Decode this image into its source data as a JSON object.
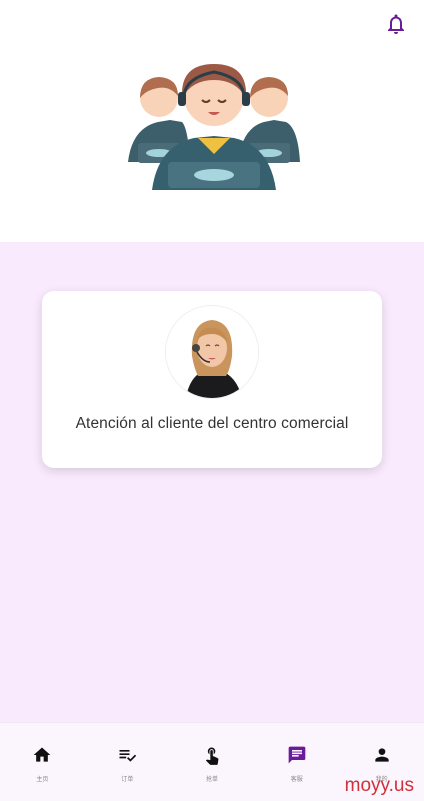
{
  "colors": {
    "accent": "#6a1b9a",
    "panel_background": "#f9ebfd",
    "nav_background": "#fbf6fd",
    "watermark": "#d0303a"
  },
  "header": {
    "notification_icon": "bell-icon"
  },
  "hero": {
    "image": "customer-service-team-illustration"
  },
  "card": {
    "avatar": "support-agent-photo",
    "label": "Atención al cliente del centro comercial"
  },
  "bottom_nav": {
    "items": [
      {
        "icon": "home-icon",
        "label": "主页"
      },
      {
        "icon": "playlist-check-icon",
        "label": "订单"
      },
      {
        "icon": "touch-icon",
        "label": "抢单"
      },
      {
        "icon": "message-icon",
        "label": "客服",
        "active": true
      },
      {
        "icon": "person-icon",
        "label": "我的"
      }
    ]
  },
  "watermark": "moyy.us"
}
